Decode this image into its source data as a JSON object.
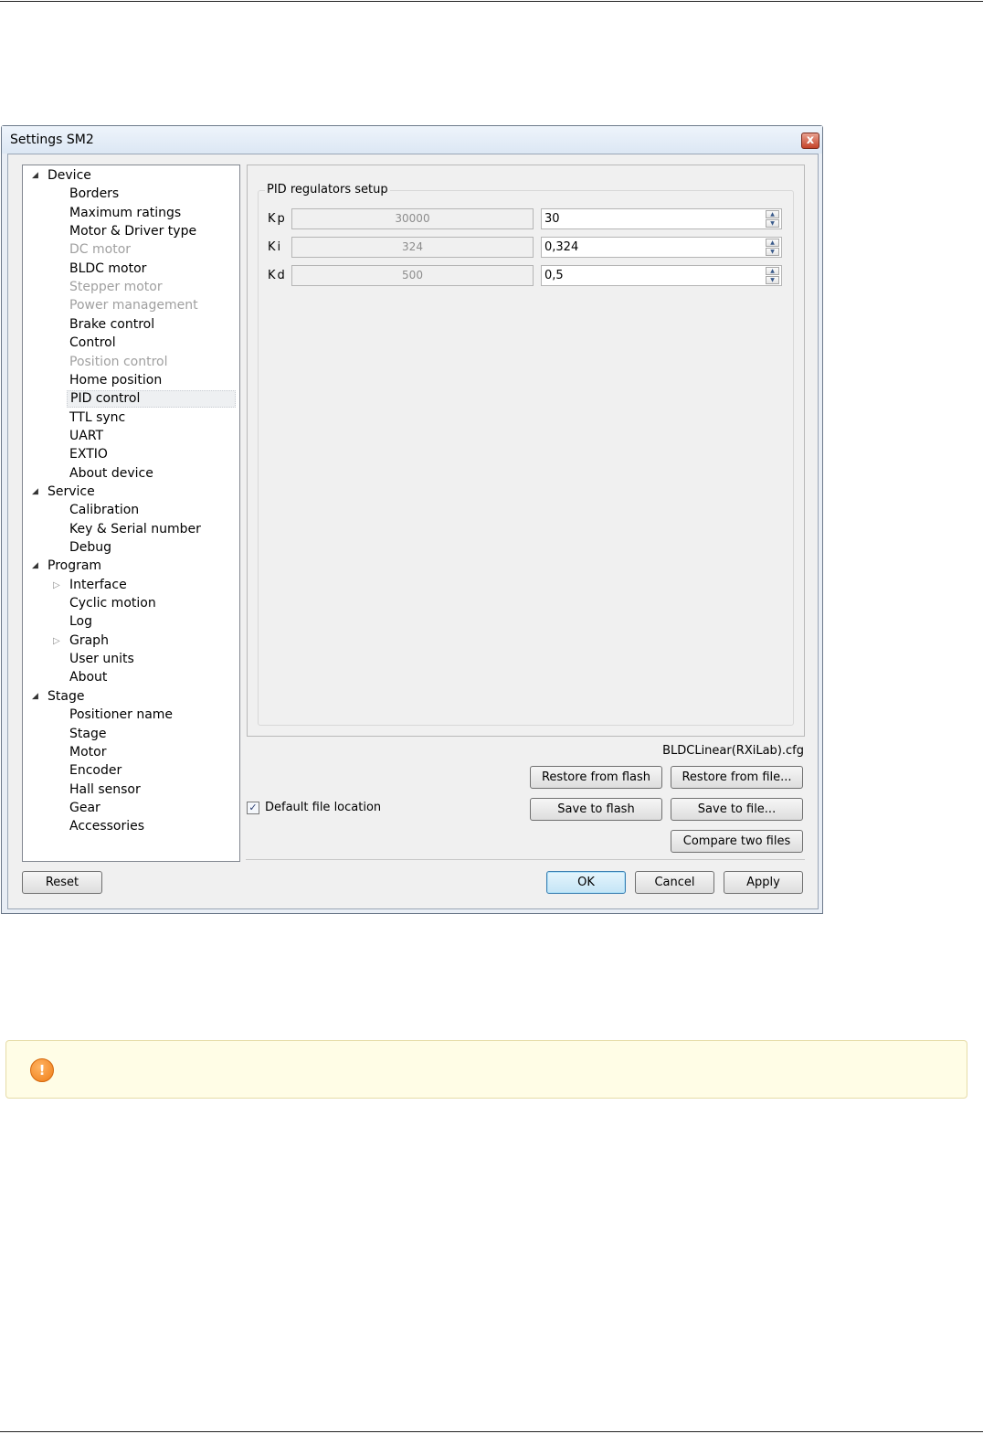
{
  "window": {
    "title": "Settings SM2",
    "close_glyph": "x"
  },
  "tree": [
    {
      "label": "Device",
      "level": 0,
      "expanded": true
    },
    {
      "label": "Borders",
      "level": 1
    },
    {
      "label": "Maximum ratings",
      "level": 1
    },
    {
      "label": "Motor & Driver type",
      "level": 1
    },
    {
      "label": "DC motor",
      "level": 1,
      "disabled": true
    },
    {
      "label": "BLDC motor",
      "level": 1
    },
    {
      "label": "Stepper motor",
      "level": 1,
      "disabled": true
    },
    {
      "label": "Power management",
      "level": 1,
      "disabled": true
    },
    {
      "label": "Brake control",
      "level": 1
    },
    {
      "label": "Control",
      "level": 1
    },
    {
      "label": "Position control",
      "level": 1,
      "disabled": true
    },
    {
      "label": "Home position",
      "level": 1
    },
    {
      "label": "PID control",
      "level": 1,
      "selected": true
    },
    {
      "label": "TTL sync",
      "level": 1
    },
    {
      "label": "UART",
      "level": 1
    },
    {
      "label": "EXTIO",
      "level": 1
    },
    {
      "label": "About device",
      "level": 1
    },
    {
      "label": "Service",
      "level": 0,
      "expanded": true
    },
    {
      "label": "Calibration",
      "level": 1
    },
    {
      "label": "Key & Serial number",
      "level": 1
    },
    {
      "label": "Debug",
      "level": 1
    },
    {
      "label": "Program",
      "level": 0,
      "expanded": true
    },
    {
      "label": "Interface",
      "level": 1,
      "collapsed_children": true
    },
    {
      "label": "Cyclic motion",
      "level": 1
    },
    {
      "label": "Log",
      "level": 1
    },
    {
      "label": "Graph",
      "level": 1,
      "collapsed_children": true
    },
    {
      "label": "User units",
      "level": 1
    },
    {
      "label": "About",
      "level": 1
    },
    {
      "label": "Stage",
      "level": 0,
      "expanded": true
    },
    {
      "label": "Positioner name",
      "level": 1
    },
    {
      "label": "Stage",
      "level": 1
    },
    {
      "label": "Motor",
      "level": 1
    },
    {
      "label": "Encoder",
      "level": 1
    },
    {
      "label": "Hall sensor",
      "level": 1
    },
    {
      "label": "Gear",
      "level": 1
    },
    {
      "label": "Accessories",
      "level": 1
    }
  ],
  "pid": {
    "group_title": "PID regulators setup",
    "rows": [
      {
        "label": "Kp",
        "raw": "30000",
        "value": "30"
      },
      {
        "label": "Ki",
        "raw": "324",
        "value": "0,324"
      },
      {
        "label": "Kd",
        "raw": "500",
        "value": "0,5"
      }
    ]
  },
  "file": {
    "name": "BLDCLinear(RXiLab).cfg"
  },
  "buttons": {
    "restore_flash": "Restore from flash",
    "restore_file": "Restore from file...",
    "save_flash": "Save to flash",
    "save_file": "Save to file...",
    "compare": "Compare two files",
    "reset": "Reset",
    "ok": "OK",
    "cancel": "Cancel",
    "apply": "Apply"
  },
  "default_location": {
    "label": "Default file location",
    "checked": true,
    "check_glyph": "✓"
  },
  "warning": {
    "icon": "exclamation-circle-icon",
    "glyph": "!",
    "color": "#ef7d17"
  }
}
